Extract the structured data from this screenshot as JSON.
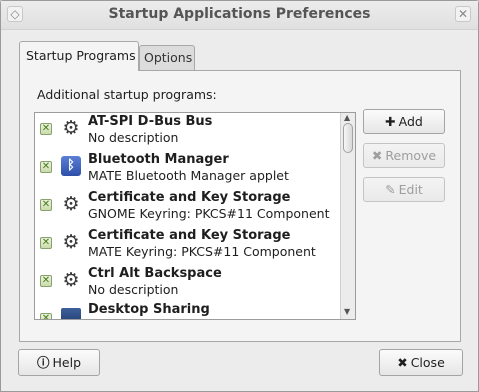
{
  "window": {
    "title": "Startup Applications Preferences"
  },
  "tabs": [
    {
      "label": "Startup Programs",
      "active": true
    },
    {
      "label": "Options",
      "active": false
    }
  ],
  "section_label": "Additional startup programs:",
  "items": [
    {
      "name": "AT-SPI D-Bus Bus",
      "description": "No description",
      "enabled": true,
      "icon": "gear-icon"
    },
    {
      "name": "Bluetooth Manager",
      "description": "MATE Bluetooth Manager applet",
      "enabled": true,
      "icon": "bluetooth-icon"
    },
    {
      "name": "Certificate and Key Storage",
      "description": "GNOME Keyring: PKCS#11 Component",
      "enabled": true,
      "icon": "gear-icon"
    },
    {
      "name": "Certificate and Key Storage",
      "description": "MATE Keyring: PKCS#11 Component",
      "enabled": true,
      "icon": "gear-icon"
    },
    {
      "name": "Ctrl Alt Backspace",
      "description": "No description",
      "enabled": true,
      "icon": "gear-icon"
    },
    {
      "name": "Desktop Sharing",
      "description": "",
      "enabled": true,
      "icon": "desktop-sharing-icon"
    }
  ],
  "side_buttons": {
    "add": {
      "label": "Add",
      "enabled": true
    },
    "remove": {
      "label": "Remove",
      "enabled": false
    },
    "edit": {
      "label": "Edit",
      "enabled": false
    }
  },
  "footer": {
    "help": "Help",
    "close": "Close"
  }
}
